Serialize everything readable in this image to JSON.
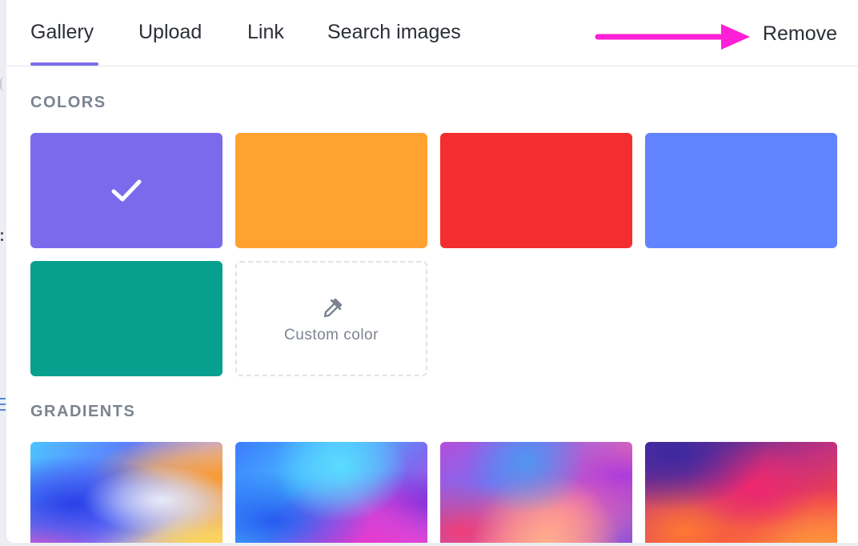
{
  "tabs": [
    {
      "label": "Gallery",
      "active": true
    },
    {
      "label": "Upload",
      "active": false
    },
    {
      "label": "Link",
      "active": false
    },
    {
      "label": "Search images",
      "active": false
    }
  ],
  "remove_label": "Remove",
  "annotation": {
    "arrow_color": "#ff1fd6",
    "icon": "arrow-right-icon"
  },
  "colors_section": {
    "title": "COLORS",
    "swatches": [
      {
        "name": "purple",
        "color": "#7b6bec",
        "selected": true
      },
      {
        "name": "orange",
        "color": "#ffa230",
        "selected": false
      },
      {
        "name": "red",
        "color": "#f42e2e",
        "selected": false
      },
      {
        "name": "blue",
        "color": "#6183ff",
        "selected": false
      },
      {
        "name": "teal",
        "color": "#07a08f",
        "selected": false
      }
    ],
    "custom_color": {
      "label": "Custom color",
      "icon": "eyedropper-icon"
    }
  },
  "gradients_section": {
    "title": "GRADIENTS",
    "items": [
      {
        "name": "gradient-1"
      },
      {
        "name": "gradient-2"
      },
      {
        "name": "gradient-3"
      },
      {
        "name": "gradient-4"
      }
    ]
  },
  "accent_color": "#7b6ee8"
}
